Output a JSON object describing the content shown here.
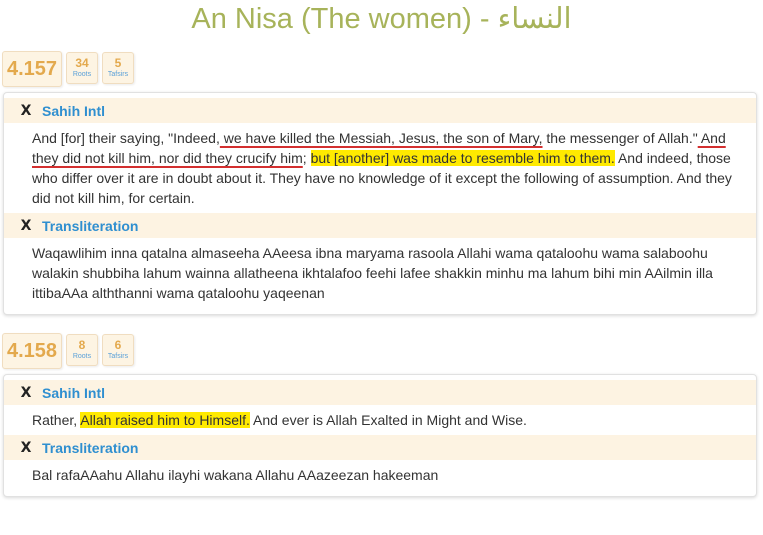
{
  "page": {
    "title": "An Nisa (The women) - النساء"
  },
  "verses": [
    {
      "number": "4.157",
      "roots_count": "34",
      "roots_label": "Roots",
      "tafsirs_count": "5",
      "tafsirs_label": "Tafsirs",
      "sahih": {
        "close": "X",
        "name": "Sahih Intl",
        "t1": "And [for] their saying, \"Indeed,",
        "t2": " we have killed the Messiah, Jesus, the son of Mary,",
        "t3": " the messenger of Allah.\"",
        "t4": " And they did not kill him, nor did they crucify him",
        "t5": "; ",
        "t6": "but [another] was made to resemble him to them.",
        "t7": " And indeed, those who differ over it are in doubt about it. They have no knowledge of it except the following of assumption. And they did not kill him, for certain."
      },
      "translit": {
        "close": "X",
        "name": "Transliteration",
        "text": "Waqawlihim inna qatalna almaseeha AAeesa ibna maryama rasoola Allahi wama qataloohu wama salaboohu walakin shubbiha lahum wainna allatheena ikhtalafoo feehi lafee shakkin minhu ma lahum bihi min AAilmin illa ittibaAAa alththanni wama qataloohu yaqeenan"
      }
    },
    {
      "number": "4.158",
      "roots_count": "8",
      "roots_label": "Roots",
      "tafsirs_count": "6",
      "tafsirs_label": "Tafsirs",
      "sahih": {
        "close": "X",
        "name": "Sahih Intl",
        "t1": "Rather, ",
        "t2": "Allah raised him to Himself.",
        "t3": " And ever is Allah Exalted in Might and Wise."
      },
      "translit": {
        "close": "X",
        "name": "Transliteration",
        "text": "Bal rafaAAahu Allahu ilayhi wakana Allahu AAazeezan hakeeman"
      }
    }
  ],
  "colors": {
    "title": "#a7b35a",
    "verse_number": "#e3a94d",
    "link_blue": "#2f8fd0",
    "highlight": "#ffea00",
    "underline": "#d32f2f"
  }
}
